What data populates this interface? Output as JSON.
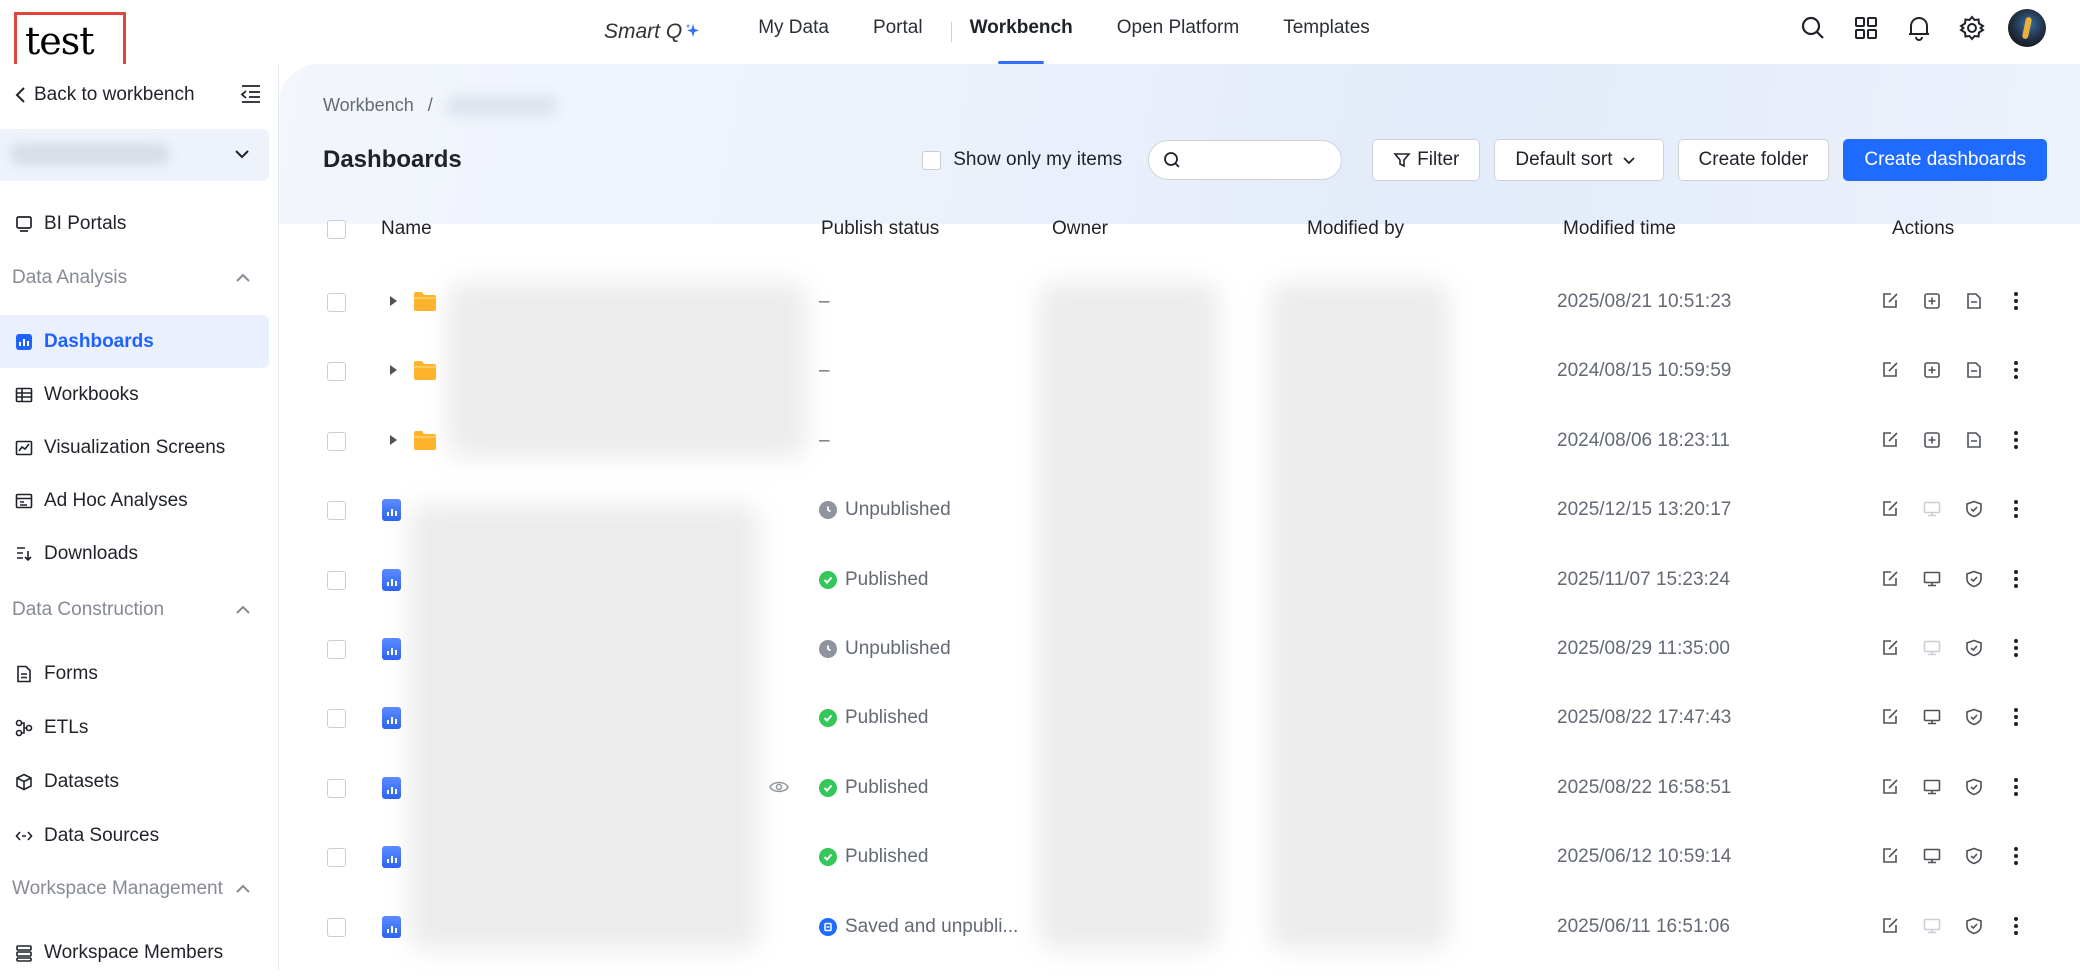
{
  "header": {
    "logo_text": "test",
    "brand": "Smart Q",
    "nav": [
      {
        "label": "My Data",
        "active": false
      },
      {
        "label": "Portal",
        "active": false
      },
      {
        "label": "Workbench",
        "active": true
      },
      {
        "label": "Open Platform",
        "active": false
      },
      {
        "label": "Templates",
        "active": false
      }
    ],
    "icons": [
      "search-icon",
      "apps-grid-icon",
      "bell-icon",
      "gear-icon",
      "avatar"
    ]
  },
  "sidebar": {
    "back_label": "Back to workbench",
    "portals_label": "BI Portals",
    "group_analysis": "Data Analysis",
    "items_analysis": [
      {
        "label": "Dashboards",
        "icon": "dashboard-icon",
        "active": true
      },
      {
        "label": "Workbooks",
        "icon": "table-icon",
        "active": false
      },
      {
        "label": "Visualization Screens",
        "icon": "chart-screen-icon",
        "active": false
      },
      {
        "label": "Ad Hoc Analyses",
        "icon": "adhoc-icon",
        "active": false
      },
      {
        "label": "Downloads",
        "icon": "download-list-icon",
        "active": false
      }
    ],
    "group_construction": "Data Construction",
    "items_construction": [
      {
        "label": "Forms",
        "icon": "form-icon"
      },
      {
        "label": "ETLs",
        "icon": "etl-icon"
      },
      {
        "label": "Datasets",
        "icon": "cube-icon"
      },
      {
        "label": "Data Sources",
        "icon": "link-icon"
      }
    ],
    "group_workspace": "Workspace Management",
    "items_workspace": [
      {
        "label": "Workspace Members",
        "icon": "members-icon"
      }
    ]
  },
  "main": {
    "breadcrumb_root": "Workbench",
    "breadcrumb_sep": "/",
    "title": "Dashboards",
    "show_mine_label": "Show only my items",
    "search_placeholder": "",
    "filter_label": "Filter",
    "sort_label": "Default sort",
    "create_folder_label": "Create folder",
    "create_dash_label": "Create dashboards",
    "columns": {
      "name": "Name",
      "publish_status": "Publish status",
      "owner": "Owner",
      "modified_by": "Modified by",
      "modified_time": "Modified time",
      "actions": "Actions"
    },
    "rows": [
      {
        "type": "folder",
        "status": "–",
        "time": "2025/08/21 10:51:23"
      },
      {
        "type": "folder",
        "status": "–",
        "time": "2024/08/15 10:59:59"
      },
      {
        "type": "folder",
        "status": "–",
        "time": "2024/08/06 18:23:11"
      },
      {
        "type": "dashboard",
        "status": "Unpublished",
        "status_kind": "unpublished",
        "time": "2025/12/15 13:20:17"
      },
      {
        "type": "dashboard",
        "status": "Published",
        "status_kind": "published",
        "time": "2025/11/07 15:23:24"
      },
      {
        "type": "dashboard",
        "status": "Unpublished",
        "status_kind": "unpublished",
        "time": "2025/08/29 11:35:00"
      },
      {
        "type": "dashboard",
        "status": "Published",
        "status_kind": "published",
        "time": "2025/08/22 17:47:43"
      },
      {
        "type": "dashboard",
        "status": "Published",
        "status_kind": "published",
        "time": "2025/08/22 16:58:51"
      },
      {
        "type": "dashboard",
        "status": "Published",
        "status_kind": "published",
        "time": "2025/06/12 10:59:14"
      },
      {
        "type": "dashboard",
        "status": "Saved and unpubli...",
        "status_kind": "saved",
        "time": "2025/06/11 16:51:06"
      }
    ],
    "colors": {
      "accent": "#1f6bff",
      "published": "#34c759",
      "unpublished": "#8f959e",
      "folder": "#ffb22c"
    }
  }
}
